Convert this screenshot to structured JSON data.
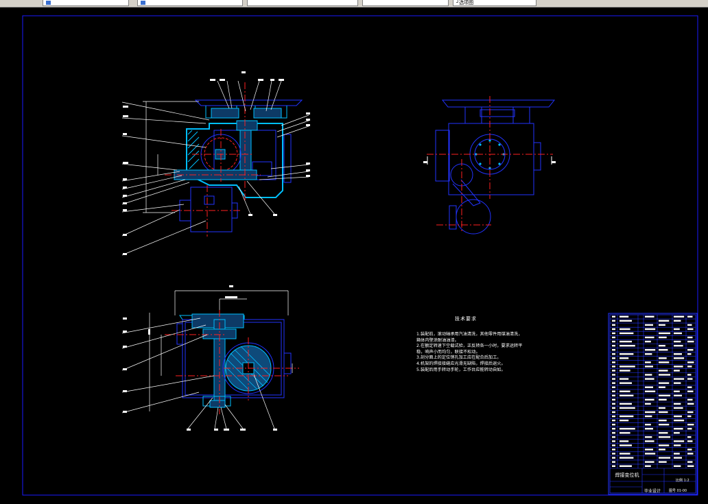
{
  "window": {
    "tabs": [
      {
        "label": ""
      },
      {
        "label": ""
      },
      {
        "label": ""
      },
      {
        "label": ""
      },
      {
        "label": "┘选项图"
      }
    ]
  },
  "drawing": {
    "frame_color": "#1a1aff",
    "part_color": "#2233ff",
    "section_color": "#00bfff",
    "centerline_color": "#ff2020",
    "leader_color": "#ffffff",
    "technical_requirements": {
      "title": "技术要求",
      "lines": [
        "1.装配前，滚动轴承用汽油清洗，其他零件用煤油清洗，",
        "箱体内壁涂耐油油漆。",
        "2.在额定转速下空载试验，正反转各一小时，要求运转平",
        "稳，响声小而均匀，联接不松动。",
        "3.剖分面上的定位销孔加工应在配合后加工。",
        "4.机架的焊接接缝应光滑无缺陷，焊接后退火。",
        "5.装配后用手转动手轮，工作台应能转动自如。"
      ]
    },
    "title_block": {
      "name": "焊接变位机",
      "subtitle": "毕业设计",
      "drawing_no": "图号 01-00",
      "scale": "比例 1:2"
    }
  }
}
